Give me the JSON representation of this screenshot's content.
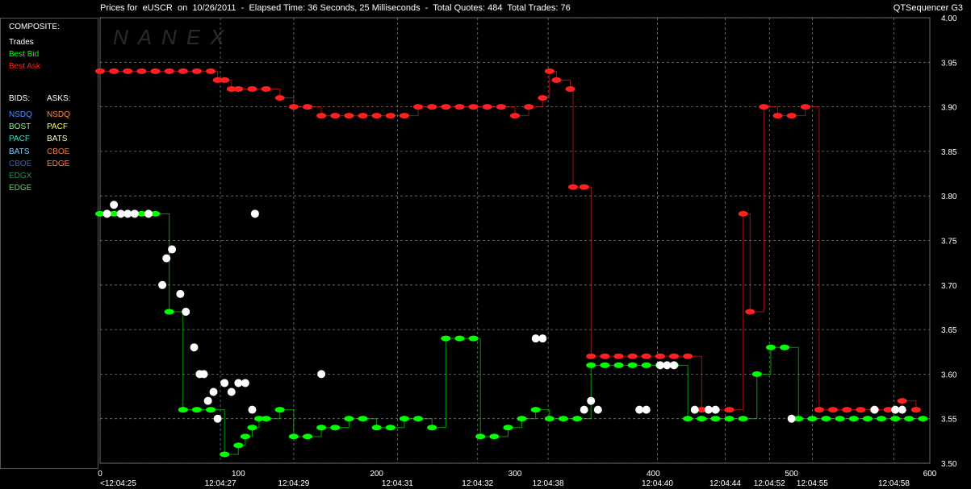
{
  "header": {
    "title": "Prices for  eUSCR  on  10/26/2011  -  Elapsed Time: 36 Seconds, 25 Milliseconds  -  Total Quotes: 484  Total Trades: 76",
    "app": "QTSequencer G3",
    "watermark": "NANEX"
  },
  "legend": {
    "composite_label": "COMPOSITE:",
    "composite": [
      {
        "label": "Trades",
        "color": "#ffffff"
      },
      {
        "label": "Best Bid",
        "color": "#00ff00"
      },
      {
        "label": "Best Ask",
        "color": "#ff2020"
      }
    ],
    "bids_label": "BIDS:",
    "asks_label": "ASKS:",
    "bids": [
      {
        "label": "NSDQ",
        "color": "#4a90ff"
      },
      {
        "label": "BOST",
        "color": "#90ee90"
      },
      {
        "label": "PACF",
        "color": "#40e0d0"
      },
      {
        "label": "BATS",
        "color": "#87cefa"
      },
      {
        "label": "CBOE",
        "color": "#3060c0"
      },
      {
        "label": "EDGX",
        "color": "#2e8b57"
      },
      {
        "label": "EDGE",
        "color": "#66cc66"
      }
    ],
    "asks": [
      {
        "label": "NSDQ",
        "color": "#ff8c40"
      },
      {
        "label": "PACF",
        "color": "#ffff40"
      },
      {
        "label": "BATS",
        "color": "#ffffcc"
      },
      {
        "label": "CBOE",
        "color": "#e08040"
      },
      {
        "label": "EDGE",
        "color": "#ff7f50"
      }
    ]
  },
  "chart_data": {
    "type": "line",
    "xlim": [
      0,
      600
    ],
    "ylim": [
      3.5,
      4.0
    ],
    "x_ticks": [
      0,
      100,
      200,
      300,
      400,
      500,
      600
    ],
    "y_ticks": [
      3.5,
      3.55,
      3.6,
      3.65,
      3.7,
      3.75,
      3.8,
      3.85,
      3.9,
      3.95,
      4.0
    ],
    "y_tick_labels": [
      "3.50",
      "3.55",
      "3.60",
      "3.65",
      "3.70",
      "3.75",
      "3.80",
      "3.85",
      "3.90",
      "3.95",
      "4.00"
    ],
    "time_labels": [
      {
        "x": 0,
        "label": "<12:04:25"
      },
      {
        "x": 87,
        "label": "12:04:27"
      },
      {
        "x": 140,
        "label": "12:04:29"
      },
      {
        "x": 215,
        "label": "12:04:31"
      },
      {
        "x": 273,
        "label": "12:04:32"
      },
      {
        "x": 324,
        "label": "12:04:38"
      },
      {
        "x": 403,
        "label": "12:04:40"
      },
      {
        "x": 452,
        "label": "12:04:44"
      },
      {
        "x": 484,
        "label": "12:04:52"
      },
      {
        "x": 515,
        "label": "12:04:55"
      },
      {
        "x": 574,
        "label": "12:04:58"
      }
    ],
    "grid": true,
    "series": [
      {
        "name": "Best Ask",
        "color": "#ff2020",
        "points": [
          [
            0,
            3.94
          ],
          [
            10,
            3.94
          ],
          [
            20,
            3.94
          ],
          [
            30,
            3.94
          ],
          [
            40,
            3.94
          ],
          [
            50,
            3.94
          ],
          [
            60,
            3.94
          ],
          [
            70,
            3.94
          ],
          [
            80,
            3.94
          ],
          [
            85,
            3.93
          ],
          [
            90,
            3.93
          ],
          [
            95,
            3.92
          ],
          [
            100,
            3.92
          ],
          [
            110,
            3.92
          ],
          [
            120,
            3.92
          ],
          [
            130,
            3.91
          ],
          [
            140,
            3.9
          ],
          [
            150,
            3.9
          ],
          [
            160,
            3.89
          ],
          [
            170,
            3.89
          ],
          [
            180,
            3.89
          ],
          [
            190,
            3.89
          ],
          [
            200,
            3.89
          ],
          [
            210,
            3.89
          ],
          [
            220,
            3.89
          ],
          [
            230,
            3.9
          ],
          [
            240,
            3.9
          ],
          [
            250,
            3.9
          ],
          [
            260,
            3.9
          ],
          [
            270,
            3.9
          ],
          [
            280,
            3.9
          ],
          [
            290,
            3.9
          ],
          [
            300,
            3.89
          ],
          [
            310,
            3.9
          ],
          [
            320,
            3.91
          ],
          [
            325,
            3.94
          ],
          [
            330,
            3.93
          ],
          [
            340,
            3.92
          ],
          [
            342,
            3.81
          ],
          [
            350,
            3.81
          ],
          [
            355,
            3.62
          ],
          [
            365,
            3.62
          ],
          [
            375,
            3.62
          ],
          [
            385,
            3.62
          ],
          [
            395,
            3.62
          ],
          [
            405,
            3.62
          ],
          [
            415,
            3.62
          ],
          [
            425,
            3.62
          ],
          [
            435,
            3.56
          ],
          [
            445,
            3.56
          ],
          [
            455,
            3.56
          ],
          [
            465,
            3.78
          ],
          [
            470,
            3.67
          ],
          [
            480,
            3.9
          ],
          [
            490,
            3.89
          ],
          [
            500,
            3.89
          ],
          [
            510,
            3.9
          ],
          [
            520,
            3.56
          ],
          [
            530,
            3.56
          ],
          [
            540,
            3.56
          ],
          [
            550,
            3.56
          ],
          [
            560,
            3.56
          ],
          [
            570,
            3.56
          ],
          [
            580,
            3.57
          ],
          [
            590,
            3.56
          ]
        ]
      },
      {
        "name": "Best Bid",
        "color": "#00ff00",
        "points": [
          [
            0,
            3.78
          ],
          [
            10,
            3.78
          ],
          [
            20,
            3.78
          ],
          [
            30,
            3.78
          ],
          [
            40,
            3.78
          ],
          [
            50,
            3.67
          ],
          [
            60,
            3.56
          ],
          [
            70,
            3.56
          ],
          [
            80,
            3.56
          ],
          [
            90,
            3.51
          ],
          [
            100,
            3.52
          ],
          [
            105,
            3.53
          ],
          [
            110,
            3.54
          ],
          [
            115,
            3.55
          ],
          [
            120,
            3.55
          ],
          [
            130,
            3.56
          ],
          [
            140,
            3.53
          ],
          [
            150,
            3.53
          ],
          [
            160,
            3.54
          ],
          [
            170,
            3.54
          ],
          [
            180,
            3.55
          ],
          [
            190,
            3.55
          ],
          [
            200,
            3.54
          ],
          [
            210,
            3.54
          ],
          [
            220,
            3.55
          ],
          [
            230,
            3.55
          ],
          [
            240,
            3.54
          ],
          [
            250,
            3.64
          ],
          [
            260,
            3.64
          ],
          [
            270,
            3.64
          ],
          [
            275,
            3.53
          ],
          [
            285,
            3.53
          ],
          [
            295,
            3.54
          ],
          [
            305,
            3.55
          ],
          [
            315,
            3.56
          ],
          [
            325,
            3.55
          ],
          [
            335,
            3.55
          ],
          [
            345,
            3.55
          ],
          [
            355,
            3.61
          ],
          [
            365,
            3.61
          ],
          [
            375,
            3.61
          ],
          [
            385,
            3.61
          ],
          [
            395,
            3.61
          ],
          [
            405,
            3.61
          ],
          [
            415,
            3.61
          ],
          [
            425,
            3.55
          ],
          [
            435,
            3.55
          ],
          [
            445,
            3.55
          ],
          [
            455,
            3.55
          ],
          [
            465,
            3.55
          ],
          [
            475,
            3.6
          ],
          [
            485,
            3.63
          ],
          [
            495,
            3.63
          ],
          [
            505,
            3.55
          ],
          [
            515,
            3.55
          ],
          [
            525,
            3.55
          ],
          [
            535,
            3.55
          ],
          [
            545,
            3.55
          ],
          [
            555,
            3.55
          ],
          [
            565,
            3.55
          ],
          [
            575,
            3.55
          ],
          [
            585,
            3.55
          ],
          [
            595,
            3.55
          ]
        ]
      },
      {
        "name": "Trades",
        "color": "#ffffff",
        "points": [
          [
            5,
            3.78
          ],
          [
            10,
            3.79
          ],
          [
            15,
            3.78
          ],
          [
            20,
            3.78
          ],
          [
            25,
            3.78
          ],
          [
            35,
            3.78
          ],
          [
            45,
            3.7
          ],
          [
            48,
            3.73
          ],
          [
            52,
            3.74
          ],
          [
            58,
            3.69
          ],
          [
            62,
            3.67
          ],
          [
            68,
            3.63
          ],
          [
            72,
            3.6
          ],
          [
            75,
            3.6
          ],
          [
            78,
            3.57
          ],
          [
            82,
            3.58
          ],
          [
            85,
            3.55
          ],
          [
            90,
            3.59
          ],
          [
            95,
            3.58
          ],
          [
            100,
            3.59
          ],
          [
            105,
            3.59
          ],
          [
            110,
            3.56
          ],
          [
            112,
            3.78
          ],
          [
            160,
            3.6
          ],
          [
            315,
            3.64
          ],
          [
            320,
            3.64
          ],
          [
            350,
            3.56
          ],
          [
            355,
            3.57
          ],
          [
            360,
            3.56
          ],
          [
            390,
            3.56
          ],
          [
            395,
            3.56
          ],
          [
            405,
            3.61
          ],
          [
            410,
            3.61
          ],
          [
            415,
            3.61
          ],
          [
            430,
            3.56
          ],
          [
            440,
            3.56
          ],
          [
            445,
            3.56
          ],
          [
            500,
            3.55
          ],
          [
            560,
            3.56
          ],
          [
            575,
            3.56
          ],
          [
            580,
            3.56
          ]
        ]
      }
    ]
  }
}
